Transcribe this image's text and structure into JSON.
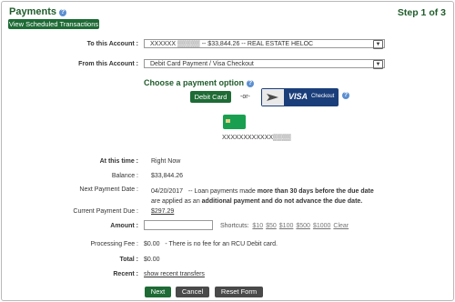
{
  "header": {
    "title": "Payments",
    "step": "Step 1 of 3"
  },
  "view_scheduled_label": "View Scheduled Transactions",
  "to_account": {
    "label": "To this Account :",
    "value": "XXXXXX  ▒▒▒▒▒  --  $33,844.26  --  REAL ESTATE HELOC"
  },
  "from_account": {
    "label": "From this Account :",
    "value": "Debit Card Payment / Visa Checkout"
  },
  "payment_option": {
    "heading": "Choose a payment option",
    "debit_label": "Debit Card",
    "or_text": "-or-",
    "visa_brand": "VISA",
    "visa_checkout": "Checkout",
    "card_number": "XXXXXXXXXXXX▒▒▒▒"
  },
  "details": {
    "at_this_time_label": "At this time :",
    "at_this_time_value": "Right Now",
    "balance_label": "Balance :",
    "balance_value": "$33,844.26",
    "next_payment_label": "Next Payment Date :",
    "next_payment_date": "04/20/2017",
    "next_payment_note_prefix": "-- Loan payments made ",
    "next_payment_note_bold1": "more than 30 days before the due date",
    "next_payment_note_mid": "are applied as an ",
    "next_payment_note_bold2": "additional payment and do not advance the due date.",
    "current_due_label": "Current Payment Due :",
    "current_due_value": "$297.29",
    "amount_label": "Amount :",
    "amount_value": "",
    "shortcuts_label": "Shortcuts:",
    "shortcuts": [
      "$10",
      "$50",
      "$100",
      "$500",
      "$1000",
      "Clear"
    ],
    "processing_fee_label": "Processing Fee :",
    "processing_fee_value": "$0.00",
    "processing_fee_note": "- There is no fee for an RCU Debit card.",
    "total_label": "Total :",
    "total_value": "$0.00",
    "recent_label": "Recent :",
    "recent_link": "show recent transfers"
  },
  "actions": {
    "next": "Next",
    "cancel": "Cancel",
    "reset": "Reset Form"
  },
  "colors": {
    "brand_green": "#1e6b35",
    "button_gray": "#4a4a4a",
    "help_blue": "#5b8fd0"
  }
}
